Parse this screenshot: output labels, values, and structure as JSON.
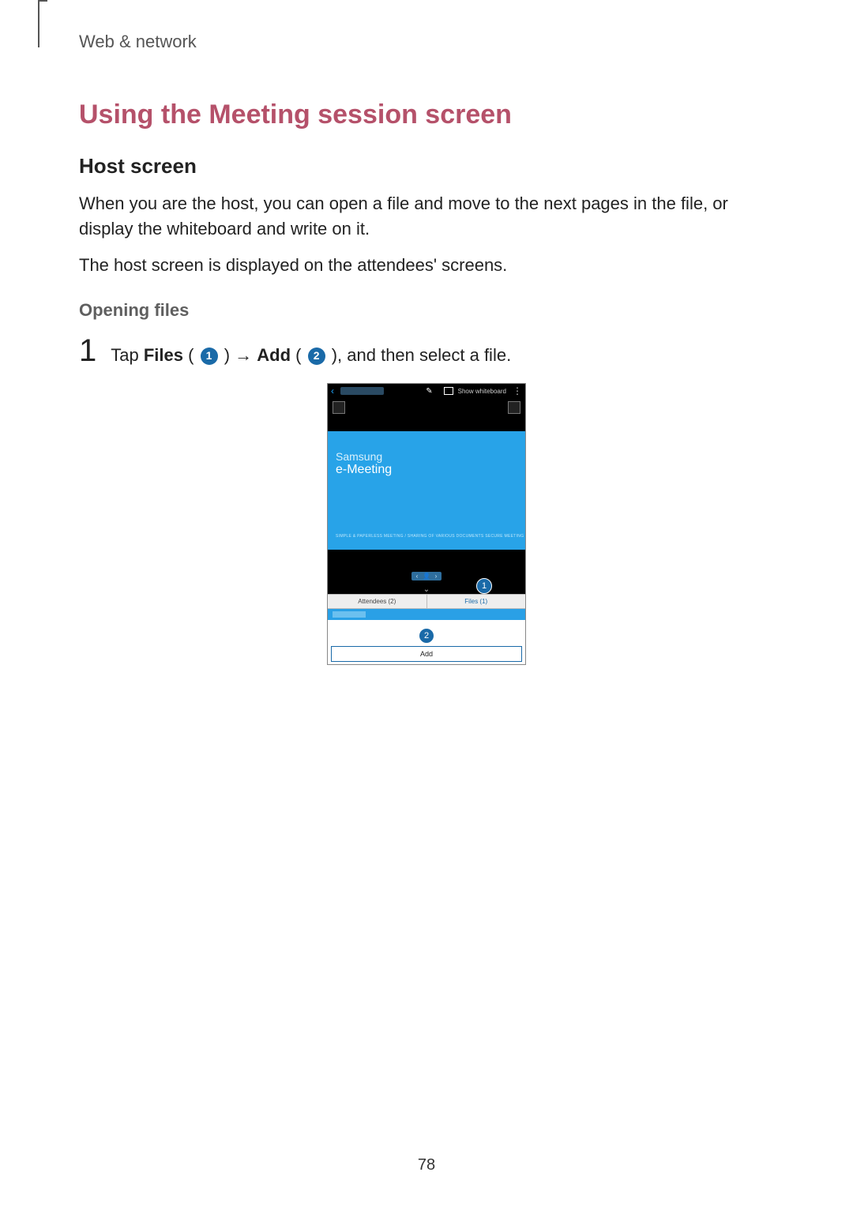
{
  "breadcrumb": "Web & network",
  "section_title": "Using the Meeting session screen",
  "sub_title": "Host screen",
  "para1": "When you are the host, you can open a file and move to the next pages in the file, or display the whiteboard and write on it.",
  "para2": "The host screen is displayed on the attendees' screens.",
  "minor_title": "Opening files",
  "step1": {
    "num": "1",
    "prefix": "Tap ",
    "b1": "Files",
    "mid1": " ( ",
    "c1": "1",
    "mid2": " ) → ",
    "b2": "Add",
    "mid3": " ( ",
    "c2": "2",
    "mid4": " ), and then select a file."
  },
  "shot": {
    "show_whiteboard": "Show whiteboard",
    "slide_line1": "Samsung",
    "slide_line2": "e-Meeting",
    "slide_tiny": "SIMPLE & PAPERLESS MEETING / SHARING OF VARIOUS DOCUMENTS\nSECURE MEETING",
    "pager_prev": "‹",
    "pager_cur": "👤",
    "pager_next": "›",
    "tab_attendees": "Attendees (2)",
    "tab_files": "Files (1)",
    "add_btn": "Add",
    "callout1": "1",
    "callout2": "2"
  },
  "page_number": "78"
}
